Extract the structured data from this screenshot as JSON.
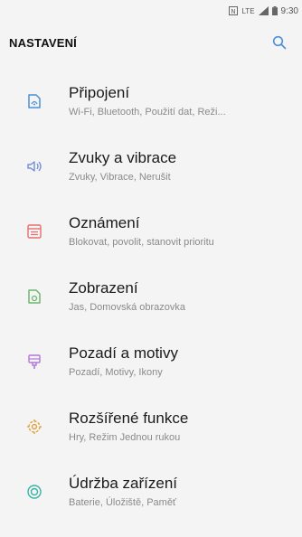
{
  "status": {
    "nfc": "N",
    "network": "LTE",
    "time": "9:30"
  },
  "header": {
    "title": "NASTAVENÍ",
    "search_icon": "search-icon"
  },
  "colors": {
    "accent": "#4a90d9",
    "connections": "#4a90d9",
    "sounds": "#6f8fd8",
    "notifications": "#e56f6f",
    "display": "#6fb86f",
    "themes": "#b07ad8",
    "advanced": "#e0a23c",
    "maintenance": "#39b3a8"
  },
  "items": [
    {
      "title": "Připojení",
      "subtitle": "Wi-Fi, Bluetooth, Použití dat, Reži...",
      "icon": "connections-icon"
    },
    {
      "title": "Zvuky a vibrace",
      "subtitle": "Zvuky, Vibrace, Nerušit",
      "icon": "sound-icon"
    },
    {
      "title": "Oznámení",
      "subtitle": "Blokovat, povolit, stanovit prioritu",
      "icon": "notifications-icon"
    },
    {
      "title": "Zobrazení",
      "subtitle": "Jas, Domovská obrazovka",
      "icon": "display-icon"
    },
    {
      "title": "Pozadí a motivy",
      "subtitle": "Pozadí, Motivy, Ikony",
      "icon": "themes-icon"
    },
    {
      "title": "Rozšířené funkce",
      "subtitle": "Hry, Režim Jednou rukou",
      "icon": "advanced-features-icon"
    },
    {
      "title": "Údržba zařízení",
      "subtitle": "Baterie, Úložiště, Paměť",
      "icon": "device-maintenance-icon"
    }
  ]
}
